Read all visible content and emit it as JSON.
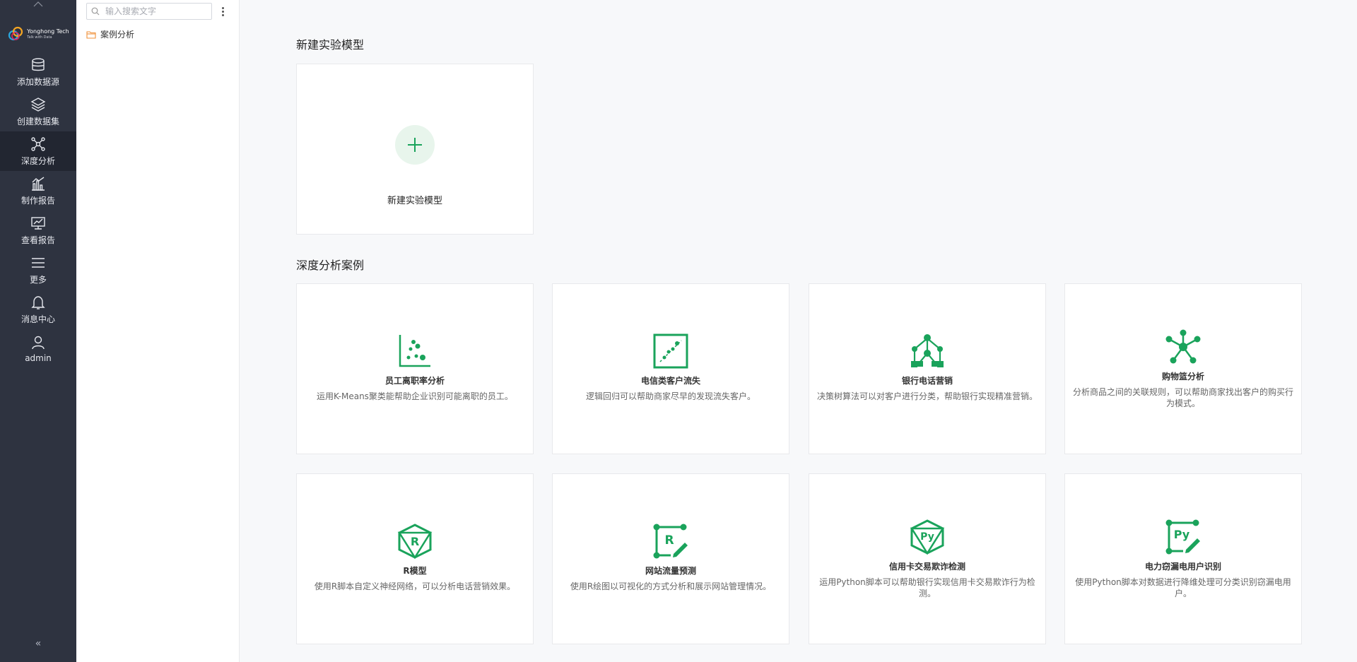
{
  "brand": {
    "name": "Yonghong Tech",
    "tagline": "Talk with Data"
  },
  "nav": {
    "items": [
      {
        "label": "添加数据源",
        "icon": "database-icon"
      },
      {
        "label": "创建数据集",
        "icon": "layers-icon"
      },
      {
        "label": "深度分析",
        "icon": "network-nodes-icon",
        "active": true
      },
      {
        "label": "制作报告",
        "icon": "bar-chart-icon"
      },
      {
        "label": "查看报告",
        "icon": "monitor-chart-icon"
      },
      {
        "label": "更多",
        "icon": "menu-icon"
      },
      {
        "label": "消息中心",
        "icon": "bell-icon"
      },
      {
        "label": "admin",
        "icon": "user-icon"
      }
    ],
    "collapse_label": "«"
  },
  "tree": {
    "search_placeholder": "输入搜索文字",
    "folder_label": "案例分析"
  },
  "main": {
    "new_section_title": "新建实验模型",
    "new_card_label": "新建实验模型",
    "cases_section_title": "深度分析案例",
    "cases": [
      {
        "title": "员工离职率分析",
        "desc": "运用K-Means聚类能帮助企业识别可能离职的员工。",
        "icon": "scatter-plot-icon"
      },
      {
        "title": "电信类客户流失",
        "desc": "逻辑回归可以帮助商家尽早的发现流失客户。",
        "icon": "regression-icon"
      },
      {
        "title": "银行电话营销",
        "desc": "决策树算法可以对客户进行分类，帮助银行实现精准营销。",
        "icon": "decision-tree-icon"
      },
      {
        "title": "购物篮分析",
        "desc": "分析商品之间的关联规则，可以帮助商家找出客户的购买行为模式。",
        "icon": "association-icon"
      },
      {
        "title": "R模型",
        "desc": "使用R脚本自定义神经网络，可以分析电话营销效果。",
        "icon": "r-model-icon"
      },
      {
        "title": "网站流量预测",
        "desc": "使用R绘图以可视化的方式分析和展示网站管理情况。",
        "icon": "r-plot-icon"
      },
      {
        "title": "信用卡交易欺诈检测",
        "desc": "运用Python脚本可以帮助银行实现信用卡交易欺诈行为检测。",
        "icon": "python-model-icon"
      },
      {
        "title": "电力窃漏电用户识别",
        "desc": "使用Python脚本对数据进行降维处理可分类识别窃漏电用户。",
        "icon": "python-edit-icon"
      }
    ]
  },
  "colors": {
    "accent": "#1aa35b",
    "nav_bg": "#2e3340",
    "nav_active": "#222631"
  }
}
